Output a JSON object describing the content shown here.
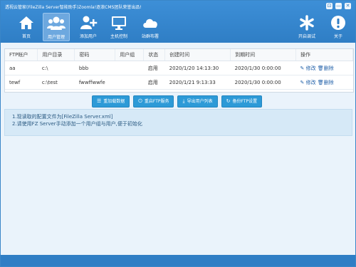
{
  "window": {
    "title": "透视云管家(FileZilla Server智能助手)Zoomla!逐浪CMS团队荣誉出品!",
    "controls": [
      "⊡",
      "—",
      "✕"
    ]
  },
  "toolbar": {
    "items": [
      {
        "label": "首页",
        "icon": "home-icon"
      },
      {
        "label": "用户管理",
        "icon": "users-icon"
      },
      {
        "label": "添加用户",
        "icon": "add-user-icon"
      },
      {
        "label": "主机控制",
        "icon": "monitor-icon"
      },
      {
        "label": "站群布署",
        "icon": "cloud-icon"
      },
      {
        "label": "开启调试",
        "icon": "asterisk-icon"
      },
      {
        "label": "关于",
        "icon": "info-icon"
      }
    ]
  },
  "table": {
    "columns": [
      "FTP帐户",
      "用户目录",
      "密码",
      "用户组",
      "状态",
      "创建时间",
      "到期时间",
      "操作"
    ],
    "rows": [
      {
        "account": "aa",
        "dir": "c:\\",
        "password": "bbb",
        "group": "",
        "status": "启用",
        "created": "2020/1/20 14:13:30",
        "expires": "2020/1/30 0:00:00"
      },
      {
        "account": "tewf",
        "dir": "c:\\test",
        "password": "fwwffwwfe",
        "group": "",
        "status": "启用",
        "created": "2020/1/21 9:13:33",
        "expires": "2020/1/30 0:00:00"
      }
    ],
    "edit_label": "修改",
    "delete_label": "删除"
  },
  "actions": [
    {
      "label": "重加载数据",
      "icon": "list-icon"
    },
    {
      "label": "重启FTP服务",
      "icon": "power-icon"
    },
    {
      "label": "导出用户列表",
      "icon": "download-icon"
    },
    {
      "label": "备份FTP设置",
      "icon": "backup-icon"
    }
  ],
  "info": {
    "line1": "1.现读取的配置文件为[FileZilla Server.xml]",
    "line2": "2.请使用FZ Server手动添加一个用户组与用户,便于初始化"
  },
  "colors": {
    "header": "#2f7ec5",
    "button": "#2d9ad7",
    "info_bg": "#d6e9f7",
    "link": "#1f5fa8"
  }
}
